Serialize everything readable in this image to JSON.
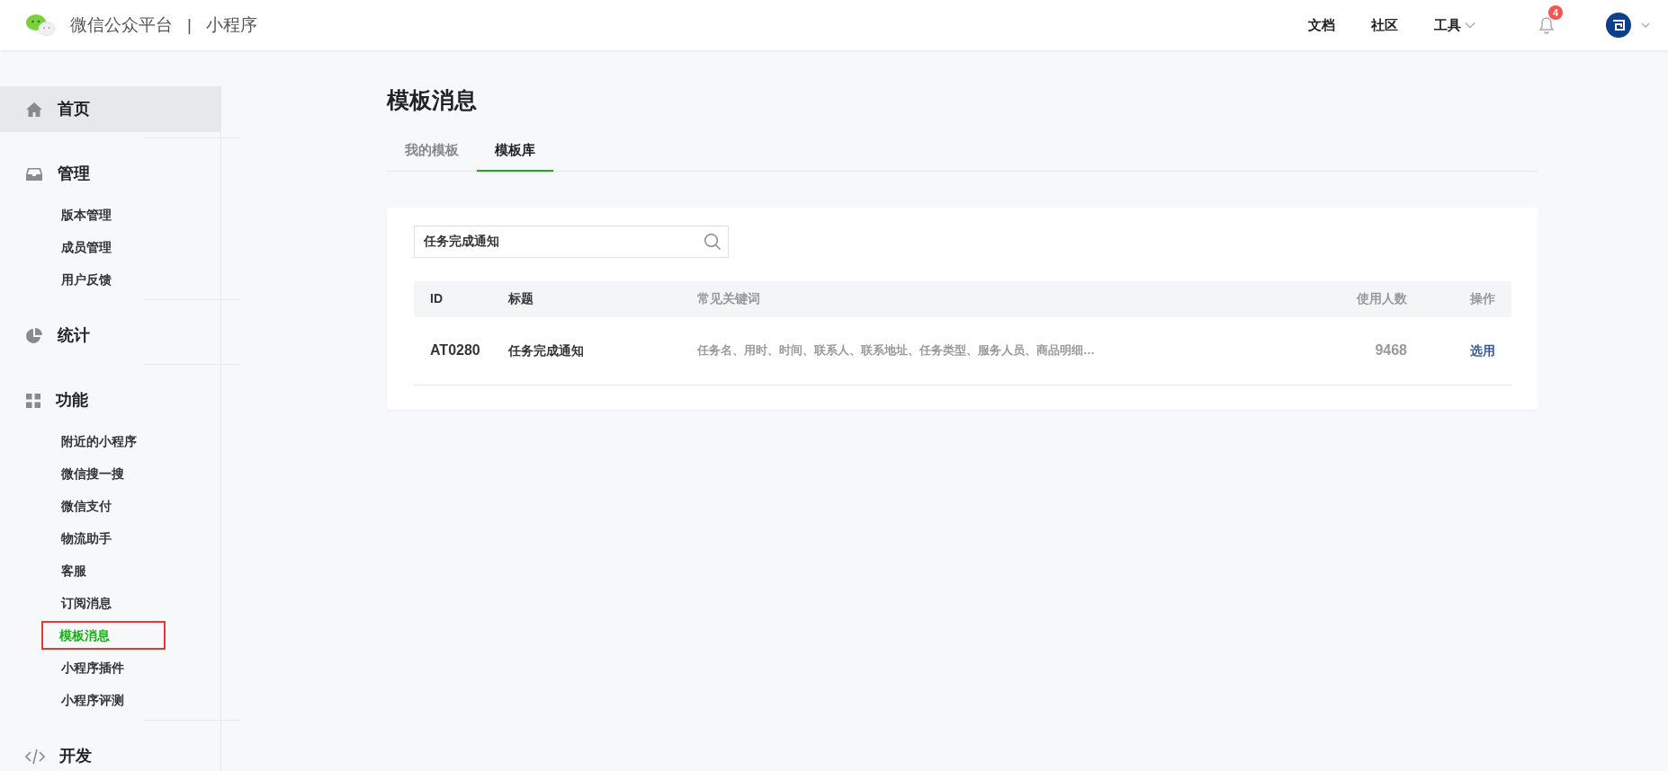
{
  "header": {
    "brand": "微信公众平台",
    "separator": "|",
    "product": "小程序",
    "links": [
      {
        "label": "文档",
        "kind": "link"
      },
      {
        "label": "社区",
        "kind": "link"
      },
      {
        "label": "工具",
        "kind": "dropdown"
      }
    ],
    "notification_count": "4"
  },
  "sidebar": {
    "sections": [
      {
        "label": "首页",
        "kind": "home",
        "selected": true
      },
      {
        "label": "管理",
        "kind": "inbox",
        "selected": false,
        "items": [
          {
            "label": "版本管理",
            "selected": false,
            "highlighted": false
          },
          {
            "label": "成员管理",
            "selected": false,
            "highlighted": false
          },
          {
            "label": "用户反馈",
            "selected": false,
            "highlighted": false
          }
        ]
      },
      {
        "label": "统计",
        "kind": "pie",
        "selected": false
      },
      {
        "label": "功能",
        "kind": "grid",
        "selected": false,
        "items": [
          {
            "label": "附近的小程序",
            "selected": false,
            "highlighted": false
          },
          {
            "label": "微信搜一搜",
            "selected": false,
            "highlighted": false
          },
          {
            "label": "微信支付",
            "selected": false,
            "highlighted": false
          },
          {
            "label": "物流助手",
            "selected": false,
            "highlighted": false
          },
          {
            "label": "客服",
            "selected": false,
            "highlighted": false
          },
          {
            "label": "订阅消息",
            "selected": false,
            "highlighted": false
          },
          {
            "label": "模板消息",
            "selected": true,
            "highlighted": true
          },
          {
            "label": "小程序插件",
            "selected": false,
            "highlighted": false
          },
          {
            "label": "小程序评测",
            "selected": false,
            "highlighted": false
          }
        ]
      },
      {
        "label": "开发",
        "kind": "code",
        "selected": false
      }
    ]
  },
  "main": {
    "title": "模板消息",
    "tabs": [
      {
        "label": "我的模板",
        "selected": false
      },
      {
        "label": "模板库",
        "selected": true
      }
    ],
    "search": {
      "value": "任务完成通知"
    },
    "table": {
      "columns": [
        "ID",
        "标题",
        "常见关键词",
        "使用人数",
        "操作"
      ],
      "rows": [
        {
          "cells": [
            "AT0280",
            "任务完成通知",
            "任务名、用时、时间、联系人、联系地址、任务类型、服务人员、商品明细…",
            "9468"
          ],
          "action": "选用"
        }
      ]
    }
  }
}
